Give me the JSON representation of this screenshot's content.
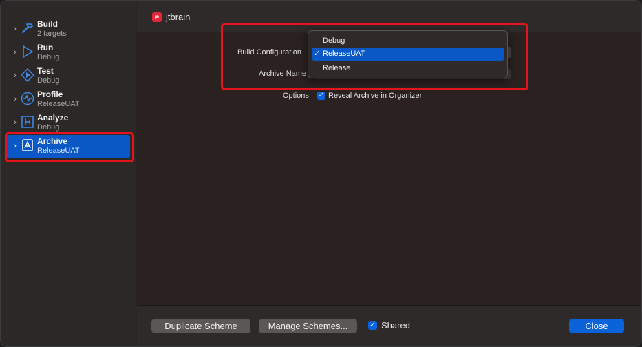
{
  "sidebar": {
    "items": [
      {
        "name": "Build",
        "sub": "2 targets",
        "icon": "hammer-icon"
      },
      {
        "name": "Run",
        "sub": "Debug",
        "icon": "play-icon"
      },
      {
        "name": "Test",
        "sub": "Debug",
        "icon": "diamond-play-icon"
      },
      {
        "name": "Profile",
        "sub": "ReleaseUAT",
        "icon": "waveform-icon"
      },
      {
        "name": "Analyze",
        "sub": "Debug",
        "icon": "analyze-icon"
      },
      {
        "name": "Archive",
        "sub": "ReleaseUAT",
        "icon": "archive-icon",
        "selected": true
      }
    ]
  },
  "header": {
    "scheme_name": "jtbrain",
    "scheme_icon_text": "jtb"
  },
  "form": {
    "build_configuration_label": "Build Configuration",
    "archive_name_label": "Archive Name",
    "options_label": "Options",
    "reveal_archive_label": "Reveal Archive in Organizer",
    "reveal_archive_checked": true
  },
  "dropdown": {
    "options": [
      "Debug",
      "ReleaseUAT",
      "Release"
    ],
    "selected": "ReleaseUAT",
    "tick": "✓"
  },
  "footer": {
    "duplicate_label": "Duplicate Scheme",
    "manage_label": "Manage Schemes...",
    "shared_label": "Shared",
    "shared_checked": true,
    "close_label": "Close"
  },
  "colors": {
    "accent": "#0a58c6",
    "highlight": "#e3141e"
  }
}
